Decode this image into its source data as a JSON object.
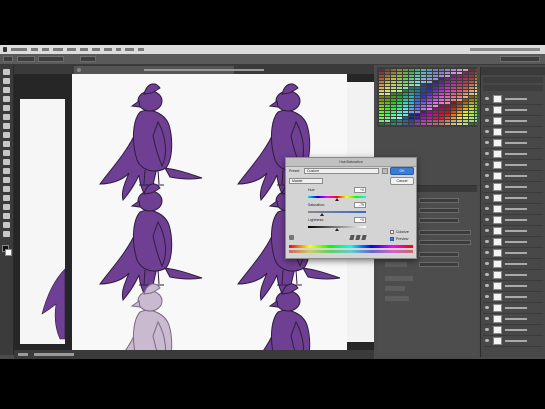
{
  "dialog": {
    "title": "Hue/Saturation",
    "preset_label": "Preset:",
    "preset_value": "Custom",
    "channel_value": "Master",
    "hue_label": "Hue:",
    "hue_value": "+0",
    "saturation_label": "Saturation:",
    "saturation_value": "-75",
    "lightness_label": "Lightness:",
    "lightness_value": "+0",
    "ok_label": "OK",
    "cancel_label": "Cancel",
    "colorize_label": "Colorize",
    "preview_label": "Preview",
    "colorize_checked": false,
    "preview_checked": true,
    "accent_color": "#3b7bd8"
  },
  "canvas": {
    "bird_color": "#6e3f92",
    "bird_outline": "#2f1d3e",
    "bird_desaturated_color": "#c9bad0"
  },
  "icons": {
    "bird": "stylized bird illustration",
    "eye": "layer-visibility-eye-icon"
  }
}
